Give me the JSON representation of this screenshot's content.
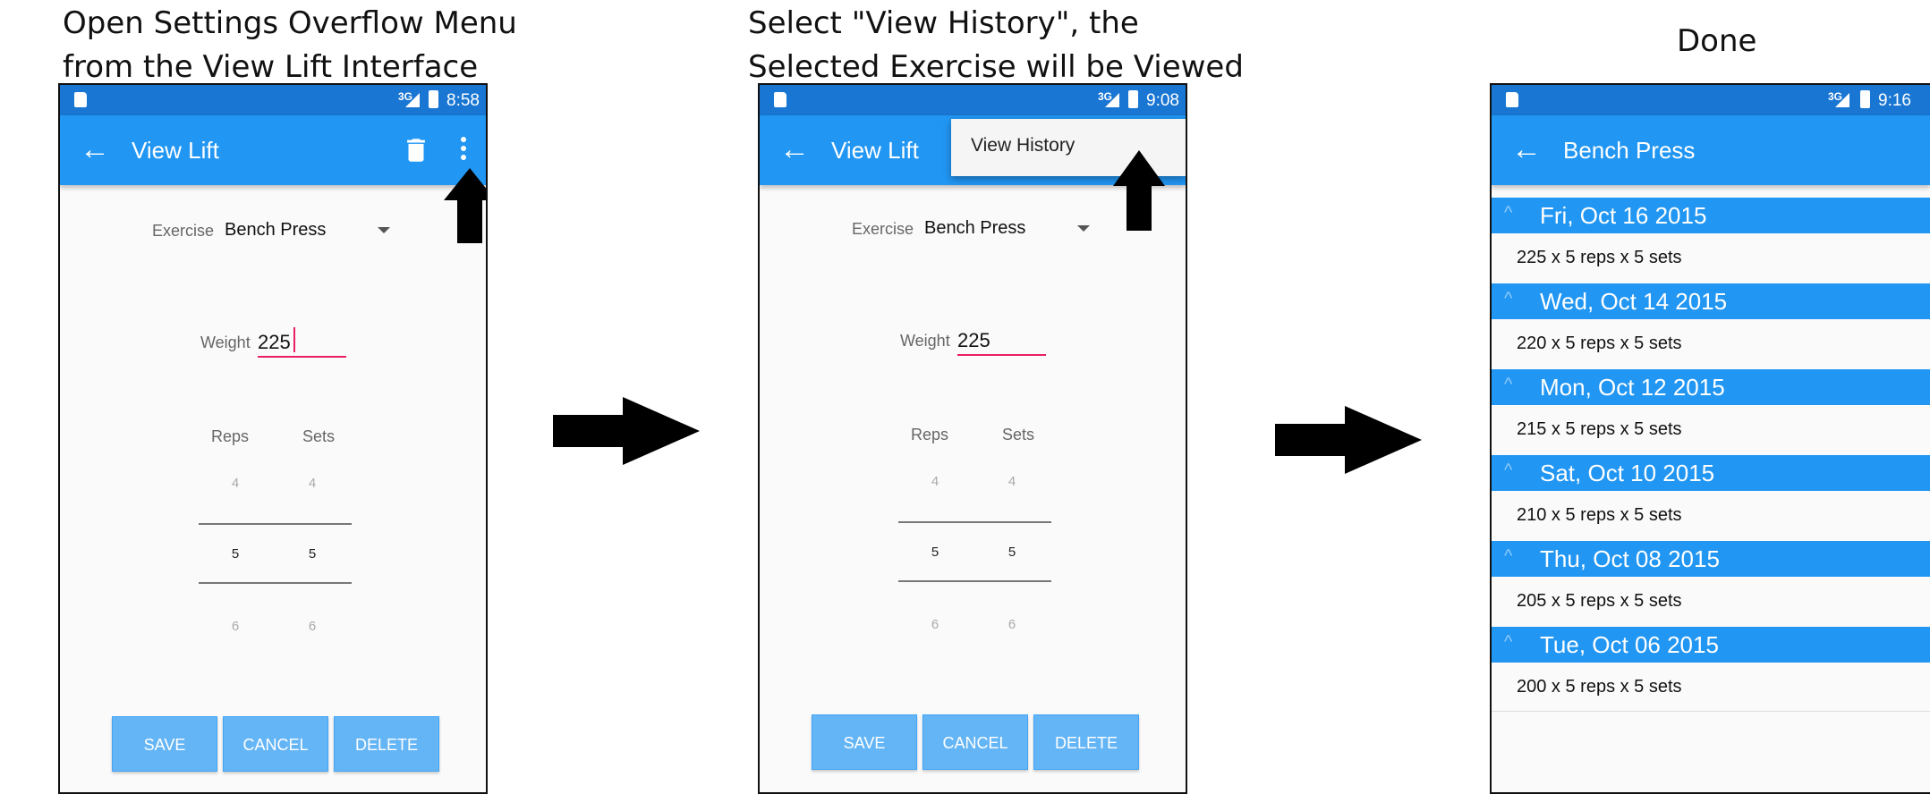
{
  "captions": {
    "step1": [
      "Open Settings Overflow Menu",
      "from the View Lift Interface"
    ],
    "step2": [
      "Select \"View History\", the",
      "Selected Exercise will be Viewed"
    ],
    "step3": "Done"
  },
  "colors": {
    "status_bar": "#1976d2",
    "app_bar": "#2196f3",
    "button": "#64b5f6",
    "accent": "#e91e63"
  },
  "screen1": {
    "status": {
      "signal": "3G",
      "time": "8:58"
    },
    "appbar": {
      "back_icon": "arrow-left-icon",
      "title": "View Lift",
      "trash_icon": "trash-icon",
      "menu_icon": "more-vert-icon"
    },
    "exercise": {
      "label": "Exercise",
      "value": "Bench Press"
    },
    "weight": {
      "label": "Weight",
      "value": "225"
    },
    "pickers": {
      "reps": {
        "label": "Reps",
        "prev": "4",
        "current": "5",
        "next": "6"
      },
      "sets": {
        "label": "Sets",
        "prev": "4",
        "current": "5",
        "next": "6"
      }
    },
    "buttons": {
      "save": "SAVE",
      "cancel": "CANCEL",
      "delete": "DELETE"
    }
  },
  "screen2": {
    "status": {
      "signal": "3G",
      "time": "9:08"
    },
    "appbar": {
      "back_icon": "arrow-left-icon",
      "title": "View Lift"
    },
    "menu": {
      "item": "View History"
    },
    "exercise": {
      "label": "Exercise",
      "value": "Bench Press"
    },
    "weight": {
      "label": "Weight",
      "value": "225"
    },
    "pickers": {
      "reps": {
        "label": "Reps",
        "prev": "4",
        "current": "5",
        "next": "6"
      },
      "sets": {
        "label": "Sets",
        "prev": "4",
        "current": "5",
        "next": "6"
      }
    },
    "buttons": {
      "save": "SAVE",
      "cancel": "CANCEL",
      "delete": "DELETE"
    }
  },
  "screen3": {
    "status": {
      "signal": "3G",
      "time": "9:16"
    },
    "appbar": {
      "back_icon": "arrow-left-icon",
      "title": "Bench Press"
    },
    "history": [
      {
        "date": "Fri, Oct 16 2015",
        "entry": "225 x 5 reps x 5 sets"
      },
      {
        "date": "Wed, Oct 14 2015",
        "entry": "220 x 5 reps x 5 sets"
      },
      {
        "date": "Mon, Oct 12 2015",
        "entry": "215 x 5 reps x 5 sets"
      },
      {
        "date": "Sat, Oct 10 2015",
        "entry": "210 x 5 reps x 5 sets"
      },
      {
        "date": "Thu, Oct 08 2015",
        "entry": "205 x 5 reps x 5 sets"
      },
      {
        "date": "Tue, Oct 06 2015",
        "entry": "200 x 5 reps x 5 sets"
      }
    ]
  }
}
